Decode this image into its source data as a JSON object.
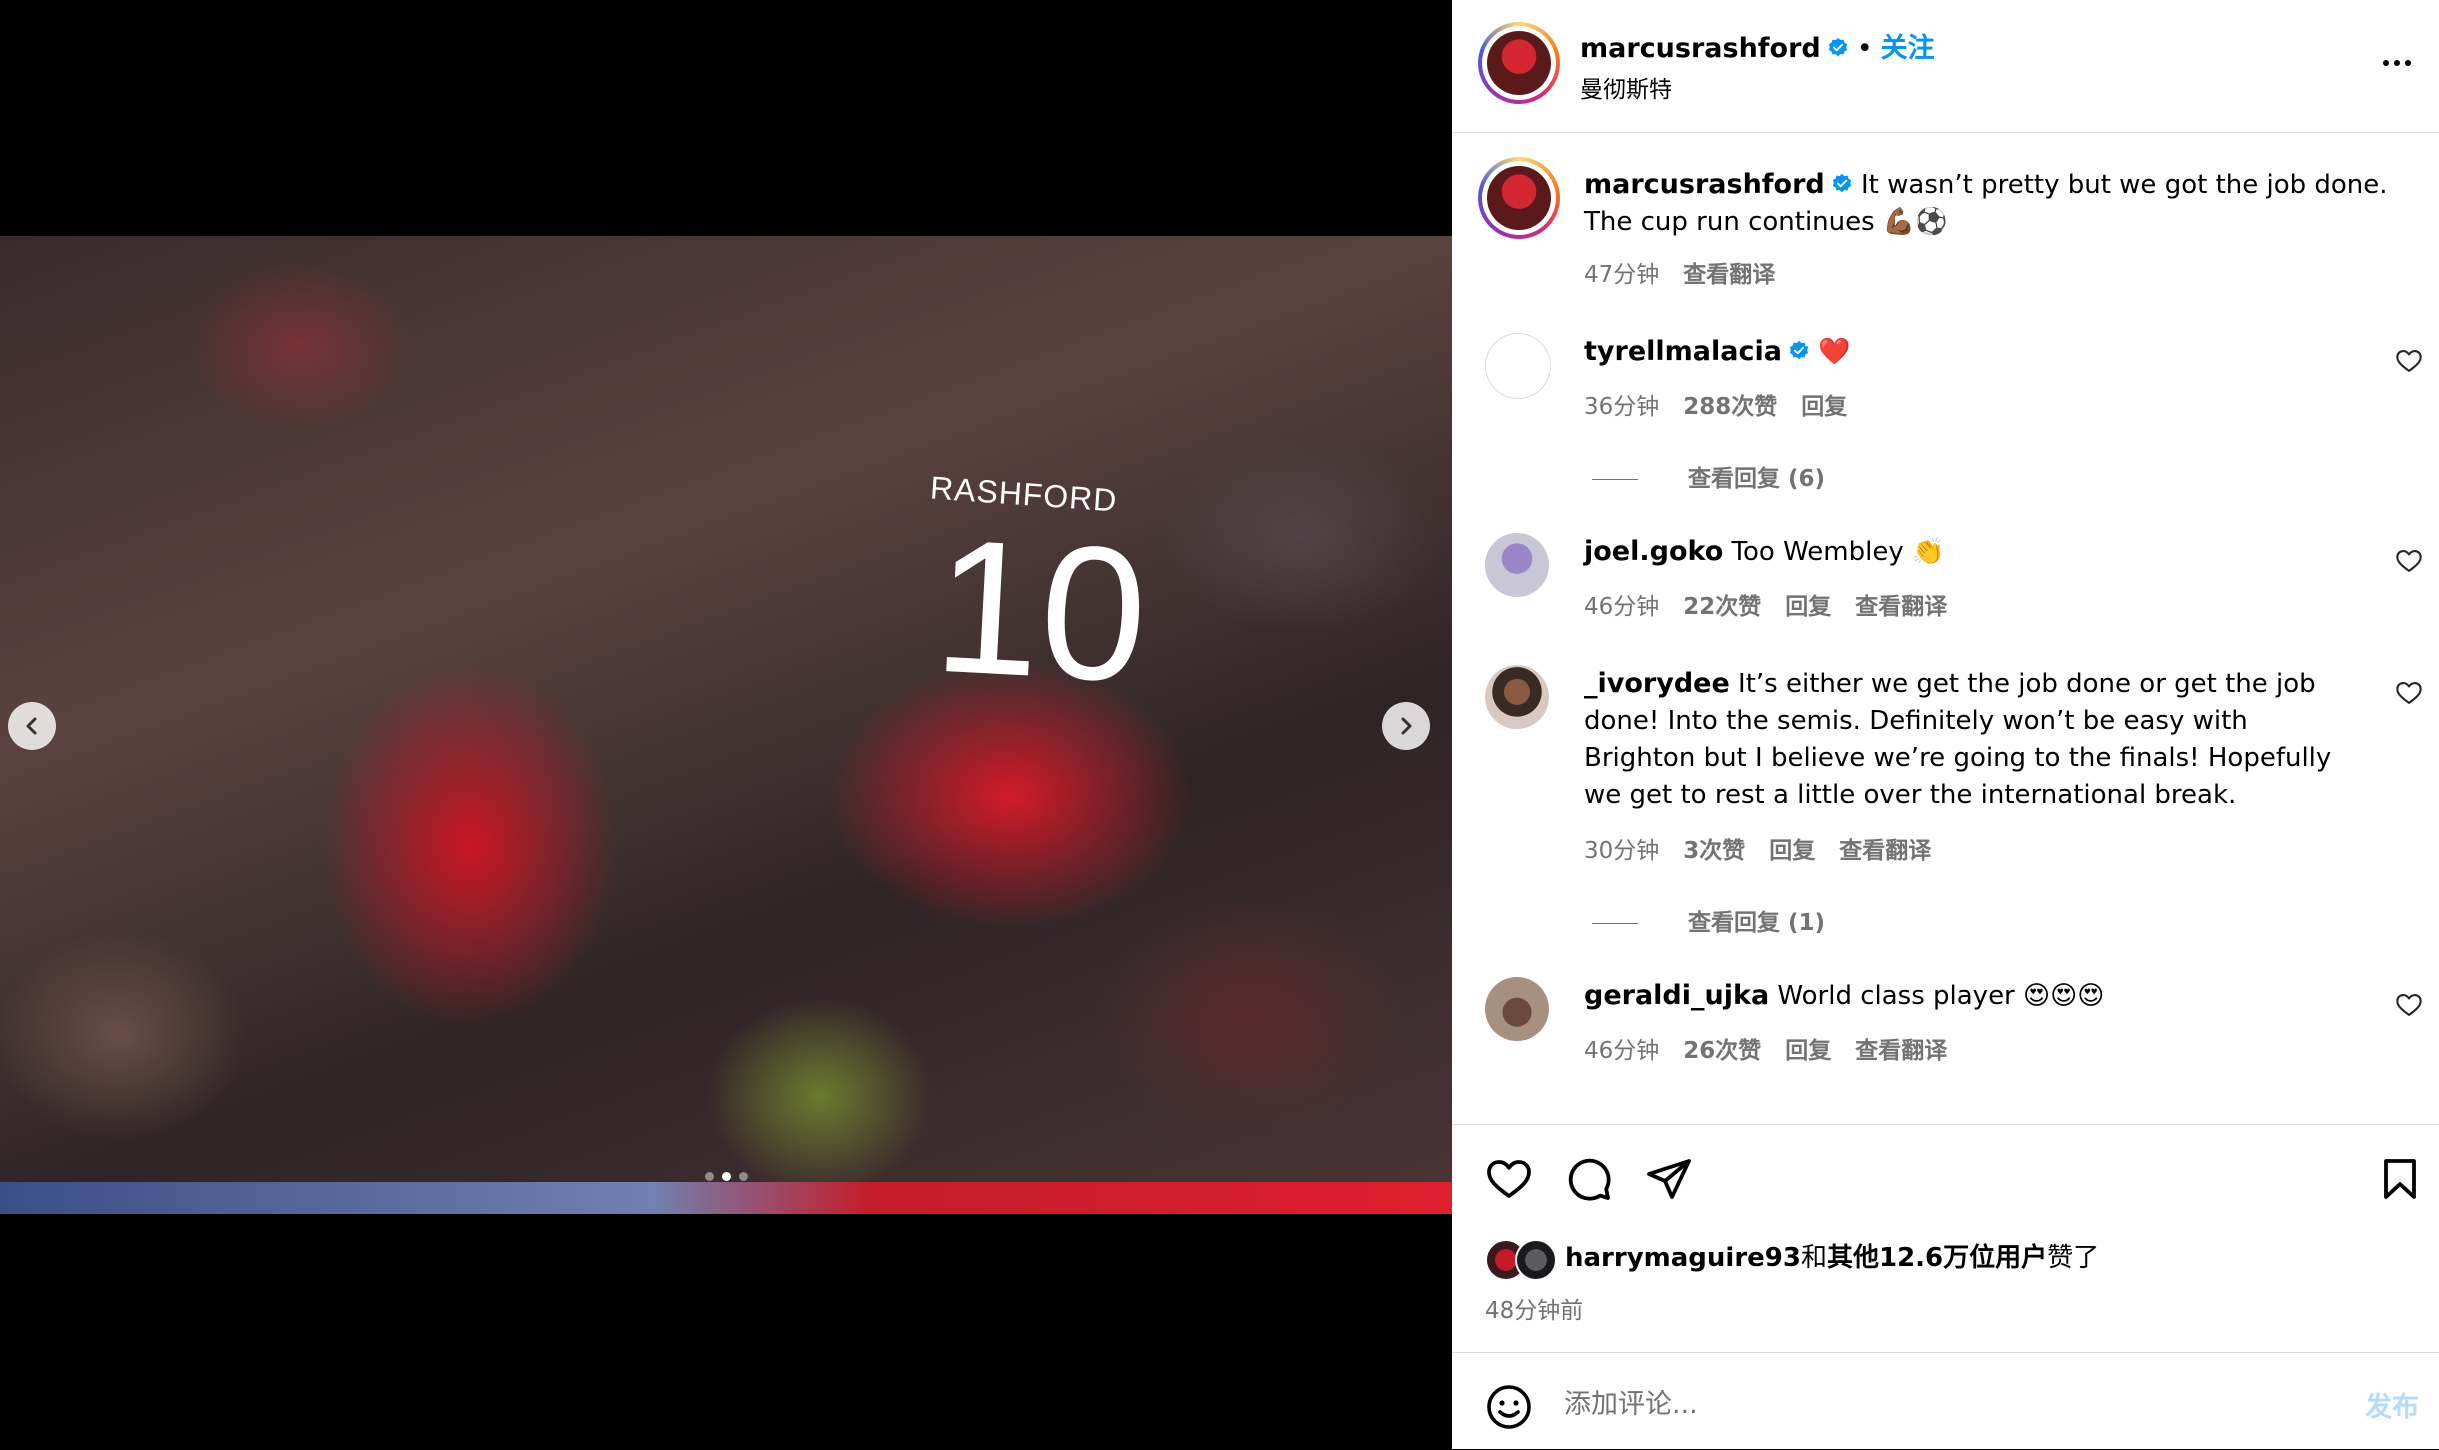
{
  "post": {
    "username": "marcusrashford",
    "follow_label": "关注",
    "bullet": "•",
    "location": "曼彻斯特",
    "caption": {
      "username": "marcusrashford",
      "text": " It wasn’t pretty but we got the job done. The cup run continues 💪🏾⚽",
      "time": "47分钟",
      "translate": "查看翻译"
    }
  },
  "photo": {
    "jersey_name": "RASHFORD",
    "jersey_number": "10",
    "slide_count": 3,
    "active_slide": 2
  },
  "comments": [
    {
      "username": "tyrellmalacia",
      "verified": true,
      "text": " ❤️",
      "time": "36分钟",
      "likes": "288次赞",
      "reply": "回复",
      "translate": "",
      "view_replies": "查看回复 (6)"
    },
    {
      "username": "joel.goko",
      "verified": false,
      "text": " Too Wembley 👏",
      "time": "46分钟",
      "likes": "22次赞",
      "reply": "回复",
      "translate": "查看翻译",
      "view_replies": ""
    },
    {
      "username": "_ivorydee",
      "verified": false,
      "text": " It’s either we get the job done or get the job done! Into the semis. Definitely won’t be easy with Brighton but I believe we’re going to the finals! Hopefully we get to rest a little over the international break.",
      "time": "30分钟",
      "likes": "3次赞",
      "reply": "回复",
      "translate": "查看翻译",
      "view_replies": "查看回复 (1)"
    },
    {
      "username": "geraldi_ujka",
      "verified": false,
      "text": " World class player 😍😍😍",
      "time": "46分钟",
      "likes": "26次赞",
      "reply": "回复",
      "translate": "查看翻译",
      "view_replies": ""
    }
  ],
  "likes": {
    "user": "harrymaguire93",
    "connector": "和",
    "others": "其他12.6万位用户",
    "suffix": "赞了"
  },
  "time_ago": "48分钟前",
  "add_comment": {
    "placeholder": "添加评论...",
    "post_label": "发布"
  },
  "colors": {
    "link": "#0095f6",
    "secondary": "#737373",
    "border": "#dbdbdb",
    "post_disabled": "#b3dbff"
  }
}
